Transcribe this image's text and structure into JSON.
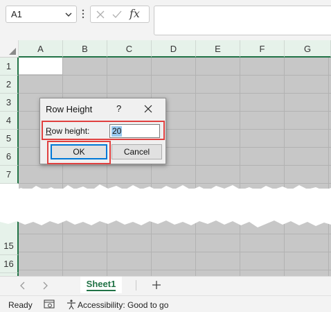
{
  "formula_bar": {
    "name_box": "A1",
    "fx_label": "fx",
    "formula_value": ""
  },
  "columns": [
    "A",
    "B",
    "C",
    "D",
    "E",
    "F",
    "G"
  ],
  "rows_top": [
    "1",
    "2",
    "3",
    "4",
    "5",
    "6",
    "7"
  ],
  "rows_bottom": [
    "15",
    "16"
  ],
  "dialog": {
    "title": "Row Height",
    "help": "?",
    "label_accel": "R",
    "label_rest": "ow height:",
    "value": "20",
    "ok": "OK",
    "cancel": "Cancel"
  },
  "sheet_tabs": {
    "active": "Sheet1"
  },
  "status_bar": {
    "ready": "Ready",
    "accessibility": "Accessibility: Good to go"
  },
  "colors": {
    "excel_green": "#217346",
    "highlight_red": "#e0403f",
    "selection_blue": "#99c9ef",
    "default_button_border": "#0078d7"
  }
}
